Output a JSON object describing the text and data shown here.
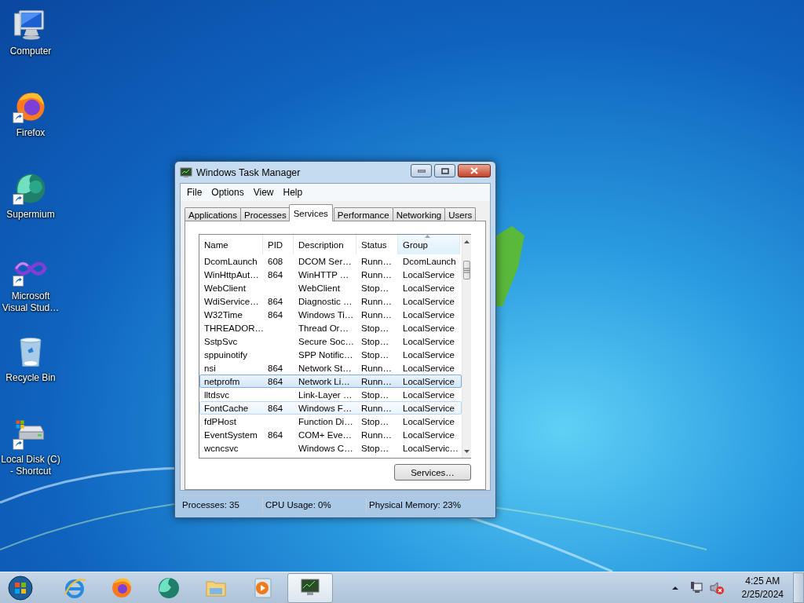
{
  "desktop_icons": [
    {
      "label": "Computer"
    },
    {
      "label": "Firefox"
    },
    {
      "label": "Supermium"
    },
    {
      "label": "Microsoft Visual Stud…"
    },
    {
      "label": "Recycle Bin"
    },
    {
      "label": "Local Disk (C) - Shortcut"
    }
  ],
  "window": {
    "title": "Windows Task Manager",
    "menu": [
      "File",
      "Options",
      "View",
      "Help"
    ],
    "tabs": [
      {
        "label": "Applications",
        "selected": false
      },
      {
        "label": "Processes",
        "selected": false
      },
      {
        "label": "Services",
        "selected": true
      },
      {
        "label": "Performance",
        "selected": false
      },
      {
        "label": "Networking",
        "selected": false
      },
      {
        "label": "Users",
        "selected": false
      }
    ],
    "table": {
      "columns": [
        {
          "label": "Name",
          "sorted": false
        },
        {
          "label": "PID",
          "sorted": false
        },
        {
          "label": "Description",
          "sorted": false
        },
        {
          "label": "Status",
          "sorted": false
        },
        {
          "label": "Group",
          "sorted": true
        }
      ],
      "rows": [
        {
          "name": "DcomLaunch",
          "pid": "608",
          "description": "DCOM Ser…",
          "status": "Runn…",
          "group": "DcomLaunch",
          "selected": false,
          "hot": false
        },
        {
          "name": "WinHttpAut…",
          "pid": "864",
          "description": "WinHTTP …",
          "status": "Runn…",
          "group": "LocalService",
          "selected": false,
          "hot": false
        },
        {
          "name": "WebClient",
          "description": "WebClient",
          "status": "Stop…",
          "group": "LocalService",
          "selected": false,
          "hot": false
        },
        {
          "name": "WdiService…",
          "pid": "864",
          "description": "Diagnostic …",
          "status": "Runn…",
          "group": "LocalService",
          "selected": false,
          "hot": false
        },
        {
          "name": "W32Time",
          "pid": "864",
          "description": "Windows Ti…",
          "status": "Runn…",
          "group": "LocalService",
          "selected": false,
          "hot": false
        },
        {
          "name": "THREADOR…",
          "description": "Thread Or…",
          "status": "Stop…",
          "group": "LocalService",
          "selected": false,
          "hot": false
        },
        {
          "name": "SstpSvc",
          "description": "Secure Soc…",
          "status": "Stop…",
          "group": "LocalService",
          "selected": false,
          "hot": false
        },
        {
          "name": "sppuinotify",
          "description": "SPP Notific…",
          "status": "Stop…",
          "group": "LocalService",
          "selected": false,
          "hot": false
        },
        {
          "name": "nsi",
          "pid": "864",
          "description": "Network St…",
          "status": "Runn…",
          "group": "LocalService",
          "selected": false,
          "hot": false
        },
        {
          "name": "netprofm",
          "pid": "864",
          "description": "Network Li…",
          "status": "Runn…",
          "group": "LocalService",
          "selected": true,
          "hot": false
        },
        {
          "name": "lltdsvc",
          "description": "Link-Layer …",
          "status": "Stop…",
          "group": "LocalService",
          "selected": false,
          "hot": false
        },
        {
          "name": "FontCache",
          "pid": "864",
          "description": "Windows F…",
          "status": "Runn…",
          "group": "LocalService",
          "selected": false,
          "hot": true
        },
        {
          "name": "fdPHost",
          "description": "Function Di…",
          "status": "Stop…",
          "group": "LocalService",
          "selected": false,
          "hot": false
        },
        {
          "name": "EventSystem",
          "pid": "864",
          "description": "COM+ Eve…",
          "status": "Runn…",
          "group": "LocalService",
          "selected": false,
          "hot": false
        },
        {
          "name": "wcncsvc",
          "description": "Windows C…",
          "status": "Stop…",
          "group": "LocalServic…",
          "selected": false,
          "hot": false
        }
      ]
    },
    "button": "Services…",
    "status_bar": [
      "Processes: 35",
      "CPU Usage: 0%",
      "Physical Memory: 23%"
    ]
  },
  "taskbar": {
    "apps": [
      {
        "active": false
      },
      {
        "active": false
      },
      {
        "active": false
      },
      {
        "active": false
      },
      {
        "active": false
      },
      {
        "active": true
      }
    ],
    "time": "4:25 AM",
    "date": "2/25/2024"
  }
}
